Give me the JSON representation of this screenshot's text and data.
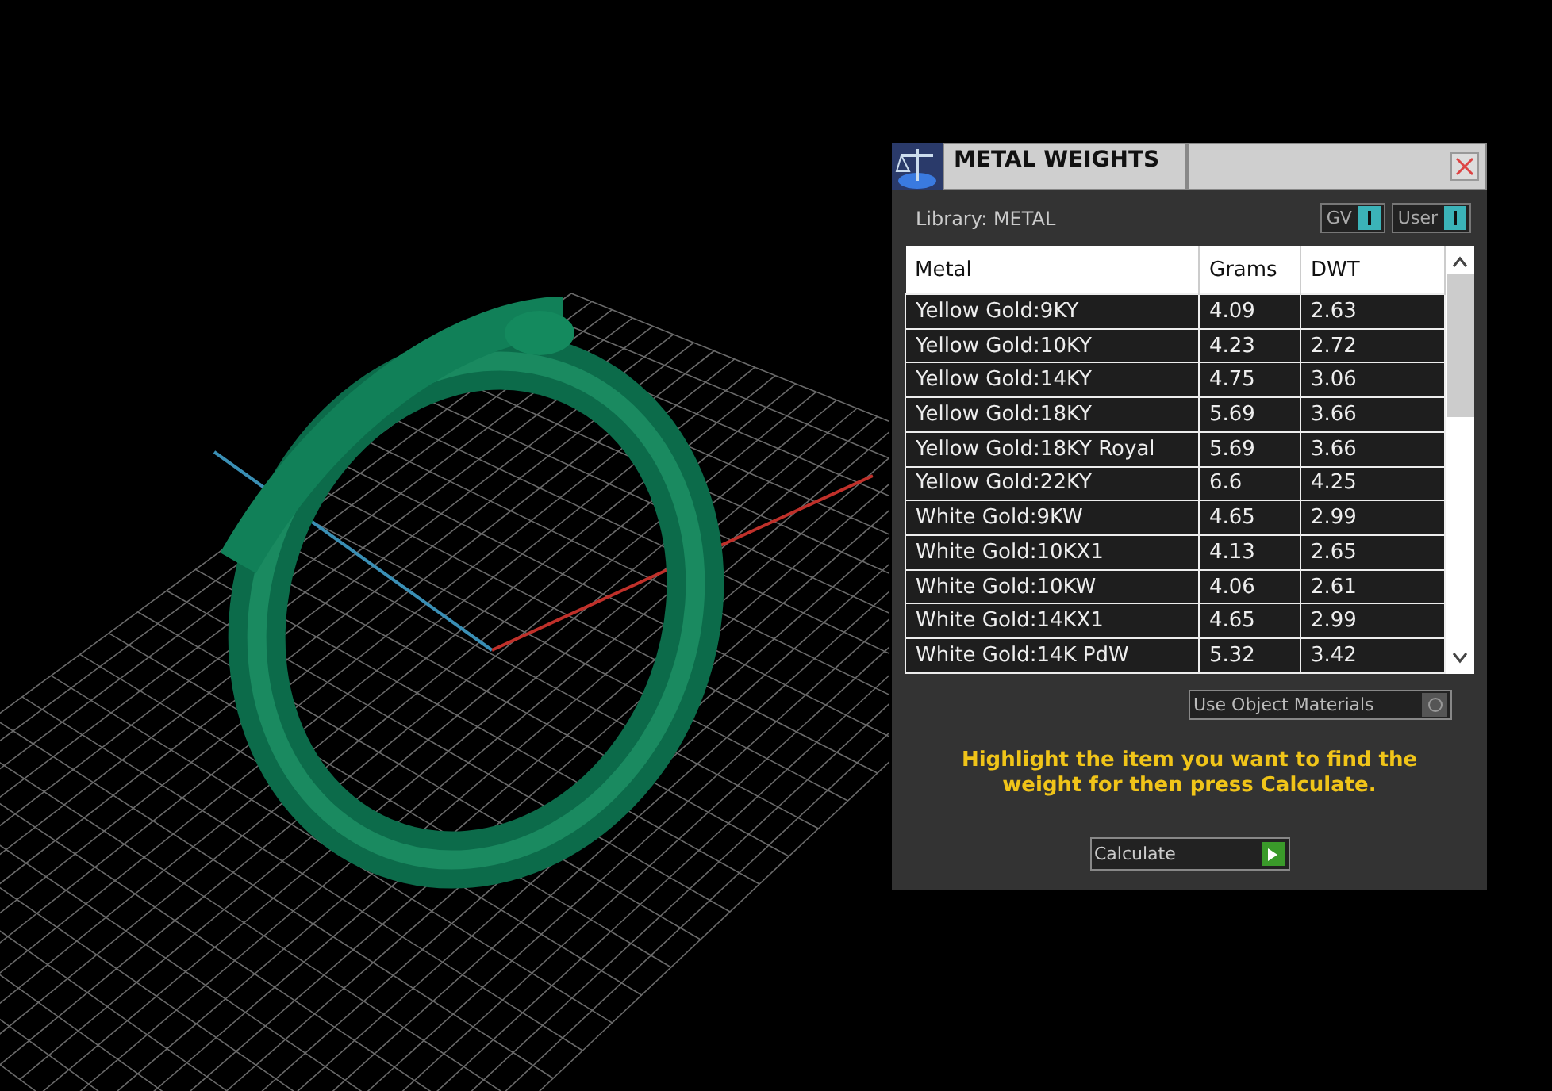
{
  "panel": {
    "title": "METAL WEIGHTS",
    "library": "Library: METAL",
    "toggles": [
      {
        "label": "GV",
        "on": true
      },
      {
        "label": "User",
        "on": true
      }
    ],
    "table": {
      "columns": [
        "Metal",
        "Grams",
        "DWT"
      ],
      "rows": [
        {
          "metal": "Yellow Gold:9KY",
          "grams": "4.09",
          "dwt": "2.63"
        },
        {
          "metal": "Yellow Gold:10KY",
          "grams": "4.23",
          "dwt": "2.72"
        },
        {
          "metal": "Yellow Gold:14KY",
          "grams": "4.75",
          "dwt": "3.06"
        },
        {
          "metal": "Yellow Gold:18KY",
          "grams": "5.69",
          "dwt": "3.66"
        },
        {
          "metal": "Yellow Gold:18KY Royal",
          "grams": "5.69",
          "dwt": "3.66"
        },
        {
          "metal": "Yellow Gold:22KY",
          "grams": "6.6",
          "dwt": "4.25"
        },
        {
          "metal": "White Gold:9KW",
          "grams": "4.65",
          "dwt": "2.99"
        },
        {
          "metal": "White Gold:10KX1",
          "grams": "4.13",
          "dwt": "2.65"
        },
        {
          "metal": "White Gold:10KW",
          "grams": "4.06",
          "dwt": "2.61"
        },
        {
          "metal": "White Gold:14KX1",
          "grams": "4.65",
          "dwt": "2.99"
        },
        {
          "metal": "White Gold:14K PdW",
          "grams": "5.32",
          "dwt": "3.42"
        }
      ]
    },
    "use_object_materials": {
      "label": "Use Object Materials",
      "on": false
    },
    "hint": "Highlight the item you want to find the weight for then press Calculate.",
    "calculate_button": "Calculate"
  }
}
